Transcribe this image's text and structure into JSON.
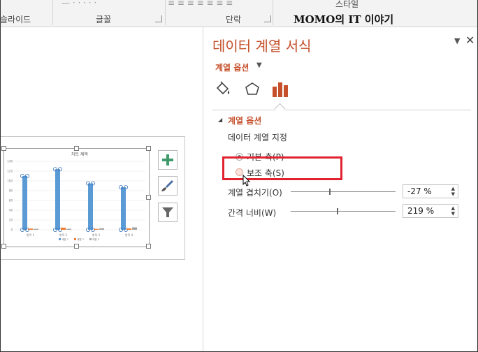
{
  "ribbon": {
    "groups": [
      {
        "label": "슬라이드"
      },
      {
        "label": "글꼴"
      },
      {
        "label": "단락"
      },
      {
        "label": "스타일"
      }
    ]
  },
  "watermark": "MOMO의 IT 이야기",
  "chart": {
    "chart_data": {
      "type": "bar",
      "title": "차트 제목",
      "categories": [
        "항목 1",
        "항목 2",
        "항목 3",
        "항목 4"
      ],
      "series": [
        {
          "name": "계열 1",
          "values": [
            110,
            124,
            95,
            87
          ]
        },
        {
          "name": "계열 2",
          "values": [
            2.4,
            4.4,
            1.8,
            2.8
          ]
        },
        {
          "name": "계열 3",
          "values": [
            2,
            2,
            3,
            5
          ]
        }
      ],
      "ylim": [
        0,
        140
      ],
      "yticks": [
        0,
        20,
        40,
        60,
        80,
        100,
        120,
        140
      ],
      "xlabel": "",
      "ylabel": "",
      "grid": true,
      "legend": "bottom"
    },
    "colors": {
      "series1": "#5b9bd5",
      "series2": "#ed7d31",
      "series3": "#a5a5a5"
    }
  },
  "chart_tools": [
    {
      "icon": "plus-icon"
    },
    {
      "icon": "brush-icon"
    },
    {
      "icon": "filter-icon"
    }
  ],
  "pane": {
    "title": "데이터 계열 서식",
    "options_label": "계열 옵션",
    "tabs": [
      {
        "icon": "paint-bucket-icon"
      },
      {
        "icon": "pentagon-icon"
      },
      {
        "icon": "bar-chart-icon"
      }
    ],
    "section": "계열 옵션",
    "plot_on": "데이터 계열 지정",
    "primary_axis": "기본 축(P)",
    "secondary_axis": "보조 축(S)",
    "overlap_label": "계열 겹치기(O)",
    "overlap_value": "-27 %",
    "overlap_fraction": 0.365,
    "gap_label": "간격 너비(W)",
    "gap_value": "219 %",
    "gap_fraction": 0.438
  },
  "colors": {
    "accent": "#c5502b",
    "highlight": "#e0232f"
  }
}
